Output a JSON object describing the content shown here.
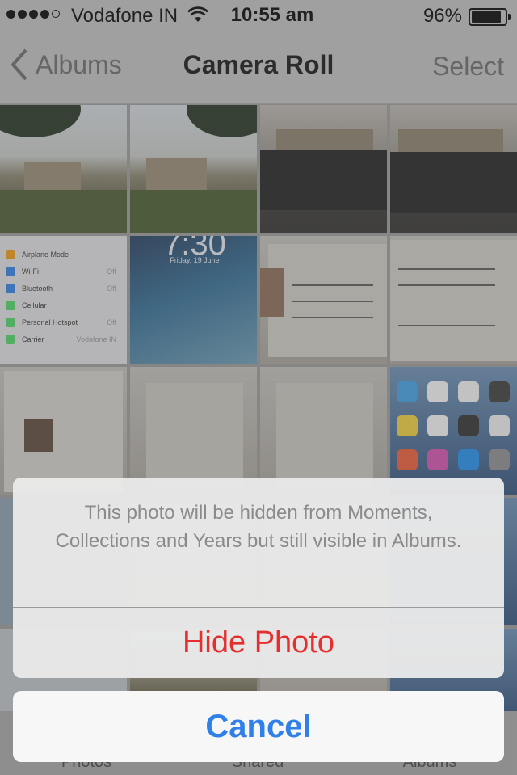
{
  "status_bar": {
    "carrier": "Vodafone IN",
    "time": "10:55 am",
    "battery": "96%",
    "battery_level": 0.96,
    "signal_bars": 4
  },
  "nav": {
    "back_label": "Albums",
    "title": "Camera Roll",
    "select_label": "Select"
  },
  "thumbnails": {
    "settings": [
      {
        "label": "Airplane Mode",
        "value": ""
      },
      {
        "label": "Wi-Fi",
        "value": "Off"
      },
      {
        "label": "Bluetooth",
        "value": "Off"
      },
      {
        "label": "Cellular",
        "value": ""
      },
      {
        "label": "Personal Hotspot",
        "value": "Off"
      },
      {
        "label": "Carrier",
        "value": "Vodafone IN"
      }
    ],
    "lock_time": "7:30",
    "lock_date": "Friday, 19 June"
  },
  "tab_bar": {
    "photos": "Photos",
    "shared": "Shared",
    "albums": "Albums"
  },
  "action_sheet": {
    "message": "This photo will be hidden from Moments, Collections and Years but still visible in Albums.",
    "hide_label": "Hide Photo",
    "cancel_label": "Cancel"
  },
  "colors": {
    "destructive": "#e62e2e",
    "tint": "#2f80e8"
  }
}
